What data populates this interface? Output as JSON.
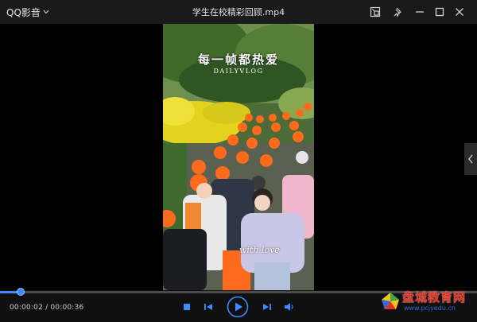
{
  "window": {
    "app_menu_label": "QQ影音",
    "file_title": "学生在校精彩回顾.mp4",
    "buttons": [
      "pip-icon",
      "pin-icon",
      "minimize-icon",
      "maximize-icon",
      "close-icon"
    ]
  },
  "video": {
    "overlay_title": "每一帧都热爱",
    "overlay_subtitle": "DAILYVLOG",
    "caption": "with love",
    "background_color": "#000000"
  },
  "playback": {
    "elapsed": "00:00:02",
    "total": "00:00:36",
    "time_display": "00:00:02 / 00:00:36",
    "progress_fraction": 0.043,
    "accent_color": "#3d8bff"
  },
  "controls": {
    "icons": [
      "stop-icon",
      "previous-icon",
      "play-icon",
      "next-icon",
      "volume-icon"
    ]
  },
  "watermark": {
    "name": "盘城教育网",
    "url": "www.pcjyedu.cn"
  }
}
